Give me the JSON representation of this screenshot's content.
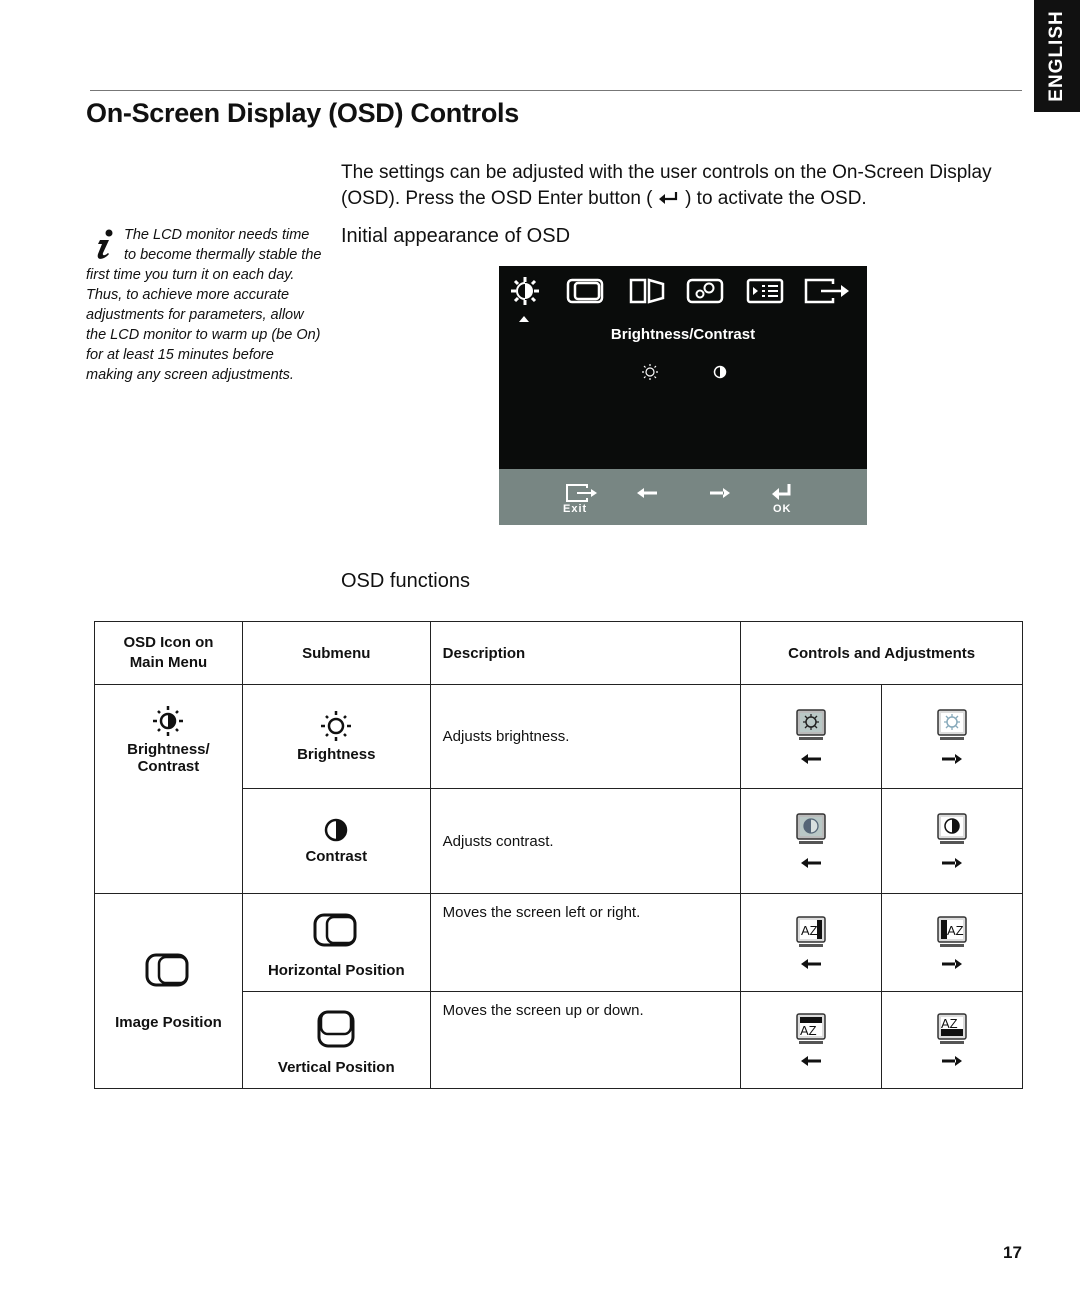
{
  "language_tab": "ENGLISH",
  "page": {
    "title": "On-Screen Display (OSD) Controls",
    "intro_line1": "The settings can be adjusted with the user controls on the On-Screen Display",
    "intro_line2_pre": "(OSD). Press the OSD Enter button (",
    "intro_line2_post": ") to activate the OSD.",
    "page_number": "17"
  },
  "note": {
    "icon": "info-icon",
    "text": "The LCD monitor needs time to become thermally stable the first time you turn it on each day. Thus, to achieve more accurate adjustments for parameters, allow the LCD monitor to warm up (be On) for at least 15 minutes before making any screen adjustments."
  },
  "sections": {
    "initial_heading": "Initial appearance of OSD",
    "functions_heading": "OSD functions"
  },
  "osd": {
    "main_icons": [
      "brightness-contrast-icon",
      "image-position-icon",
      "image-setup-icon",
      "image-properties-icon",
      "options-icon",
      "exit-icon"
    ],
    "selected_index": 0,
    "caption": "Brightness/Contrast",
    "sub_icons": [
      "brightness-icon",
      "contrast-icon"
    ],
    "bar": {
      "exit_label": "Exit",
      "ok_label": "OK"
    },
    "colors": {
      "background": "#0a0c0b",
      "bar": "#788683"
    }
  },
  "table": {
    "headers": {
      "icon": "OSD Icon on Main Menu",
      "submenu": "Submenu",
      "description": "Description",
      "controls": "Controls and Adjustments"
    },
    "groups": [
      {
        "main_label_1": "Brightness/",
        "main_label_2": "Contrast",
        "rows": [
          {
            "submenu": "Brightness",
            "description": "Adjusts brightness."
          },
          {
            "submenu": "Contrast",
            "description": "Adjusts contrast."
          }
        ]
      },
      {
        "main_label": "Image Position",
        "rows": [
          {
            "submenu": "Horizontal Position",
            "description": "Moves the screen left or right."
          },
          {
            "submenu": "Vertical Position",
            "description": "Moves the screen up or down."
          }
        ]
      }
    ]
  }
}
